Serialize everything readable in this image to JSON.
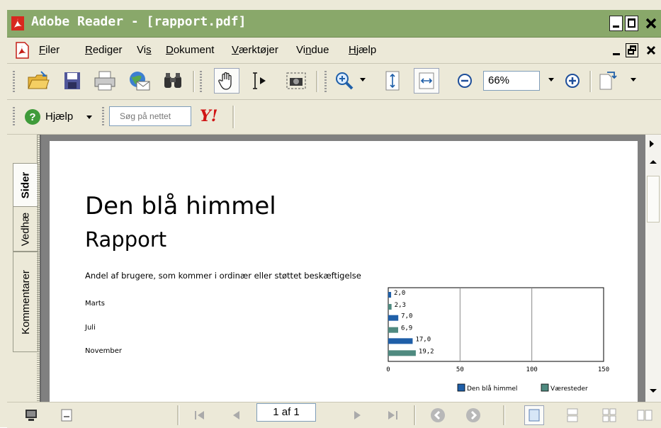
{
  "window": {
    "title": "Adobe Reader - [rapport.pdf]"
  },
  "menu": [
    {
      "label": "Filer",
      "accel": "F"
    },
    {
      "label": "Rediger",
      "accel": "R"
    },
    {
      "label": "Vis",
      "accel": "s"
    },
    {
      "label": "Dokument",
      "accel": "D"
    },
    {
      "label": "Værktøjer",
      "accel": "V"
    },
    {
      "label": "Vindue",
      "accel": "n"
    },
    {
      "label": "Hjælp",
      "accel": "H"
    }
  ],
  "toolbar": {
    "zoom_value": "66%",
    "help_label": "Hjælp",
    "search_placeholder": "Søg på nettet",
    "yahoo_label": "Y!"
  },
  "nav_tabs": [
    "Sider",
    "Vedhæ",
    "Kommentarer"
  ],
  "document": {
    "heading": "Den blå himmel",
    "subheading": "Rapport",
    "section_title": "Andel af brugere, som kommer i ordinær eller støttet beskæftigelse",
    "row_labels": [
      "Marts",
      "Juli",
      "November"
    ]
  },
  "chart_data": {
    "type": "bar",
    "orientation": "horizontal",
    "categories": [
      "Marts",
      "Juli",
      "November"
    ],
    "series": [
      {
        "name": "Den blå himmel",
        "values": [
          2.0,
          7.0,
          17.0
        ],
        "color": "#1f5fa8"
      },
      {
        "name": "Væresteder",
        "values": [
          2.3,
          6.9,
          19.2
        ],
        "color": "#4f8a80"
      }
    ],
    "data_labels": [
      [
        "2,0",
        "7,0",
        "17,0"
      ],
      [
        "2,3",
        "6,9",
        "19,2"
      ]
    ],
    "xlim": [
      0,
      150
    ],
    "xticks": [
      "0",
      "50",
      "100",
      "150"
    ],
    "grid": true,
    "legend": "bottom"
  },
  "statusbar": {
    "page_field": "1 af 1"
  },
  "colors": {
    "titlebar": "#89a86a",
    "chrome": "#ece9d8",
    "doc_background": "#808080"
  }
}
